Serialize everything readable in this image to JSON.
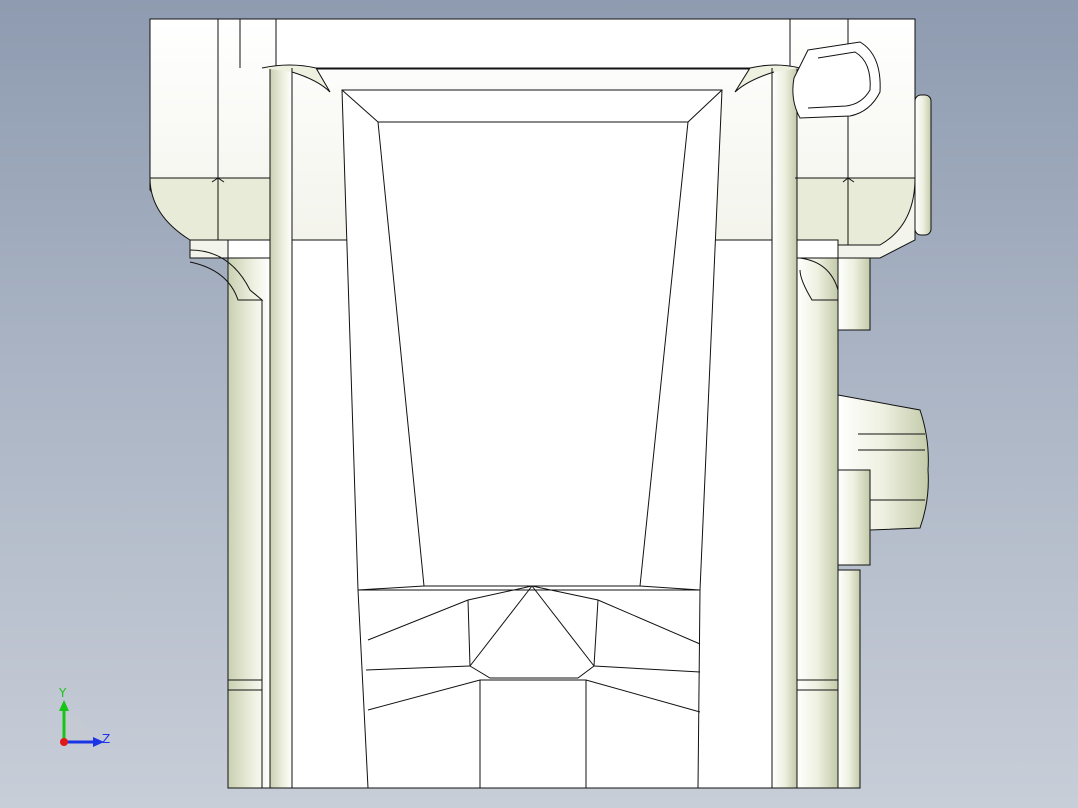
{
  "viewport": {
    "background_top": "#8e9bb0",
    "background_bottom": "#c8ced8",
    "model_fill": "#ffffff",
    "model_shade": "#d4dac0",
    "edge_color": "#111111"
  },
  "triad": {
    "y_label": "Y",
    "z_label": "Z",
    "y_color": "#19c419",
    "z_color": "#1a33e6",
    "origin_color": "#e01818"
  }
}
